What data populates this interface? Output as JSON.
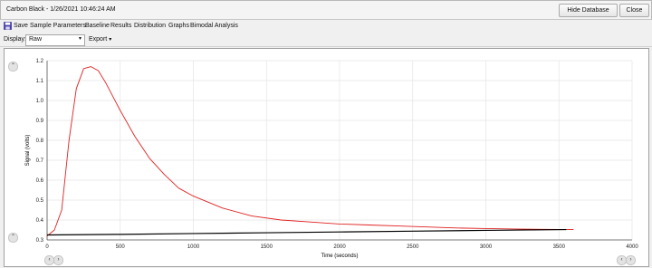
{
  "window": {
    "title": "Carbon Black - 1/26/2021 10:46:24 AM",
    "hide_database_label": "Hide Database",
    "close_label": "Close"
  },
  "menu": {
    "items": [
      "Save",
      "Sample Parameters",
      "Baseline",
      "Results",
      "Distribution",
      "Graphs",
      "Bimodal Analysis"
    ]
  },
  "toolbar": {
    "display_label": "Display:",
    "display_value": "Raw",
    "export_label": "Export"
  },
  "icons": {
    "save": "save-icon",
    "nav": "chevron-nav-icon"
  },
  "chart_data": {
    "type": "line",
    "xlabel": "Time (seconds)",
    "ylabel": "Signal (volts)",
    "xlim": [
      0,
      4000
    ],
    "ylim": [
      0.3,
      1.2
    ],
    "x_ticks": [
      0,
      500,
      1000,
      1500,
      2000,
      2500,
      3000,
      3500,
      4000
    ],
    "y_ticks": [
      0.3,
      0.4,
      0.5,
      0.6,
      0.7,
      0.8,
      0.9,
      1.0,
      1.1,
      1.2
    ],
    "grid": true,
    "series": [
      {
        "color": "#e02020",
        "x": [
          0,
          50,
          100,
          150,
          200,
          250,
          300,
          350,
          400,
          500,
          600,
          700,
          800,
          900,
          1000,
          1200,
          1400,
          1600,
          1800,
          2000,
          2200,
          2400,
          2600,
          2800,
          3000,
          3200,
          3400,
          3600
        ],
        "y": [
          0.32,
          0.35,
          0.45,
          0.8,
          1.06,
          1.16,
          1.17,
          1.15,
          1.09,
          0.95,
          0.82,
          0.71,
          0.63,
          0.56,
          0.52,
          0.46,
          0.42,
          0.4,
          0.39,
          0.38,
          0.375,
          0.37,
          0.365,
          0.36,
          0.357,
          0.355,
          0.353,
          0.352
        ]
      },
      {
        "color": "#000000",
        "x": [
          0,
          500,
          1000,
          1500,
          2000,
          2500,
          3000,
          3550
        ],
        "y": [
          0.325,
          0.328,
          0.332,
          0.336,
          0.34,
          0.344,
          0.348,
          0.352
        ]
      }
    ]
  }
}
